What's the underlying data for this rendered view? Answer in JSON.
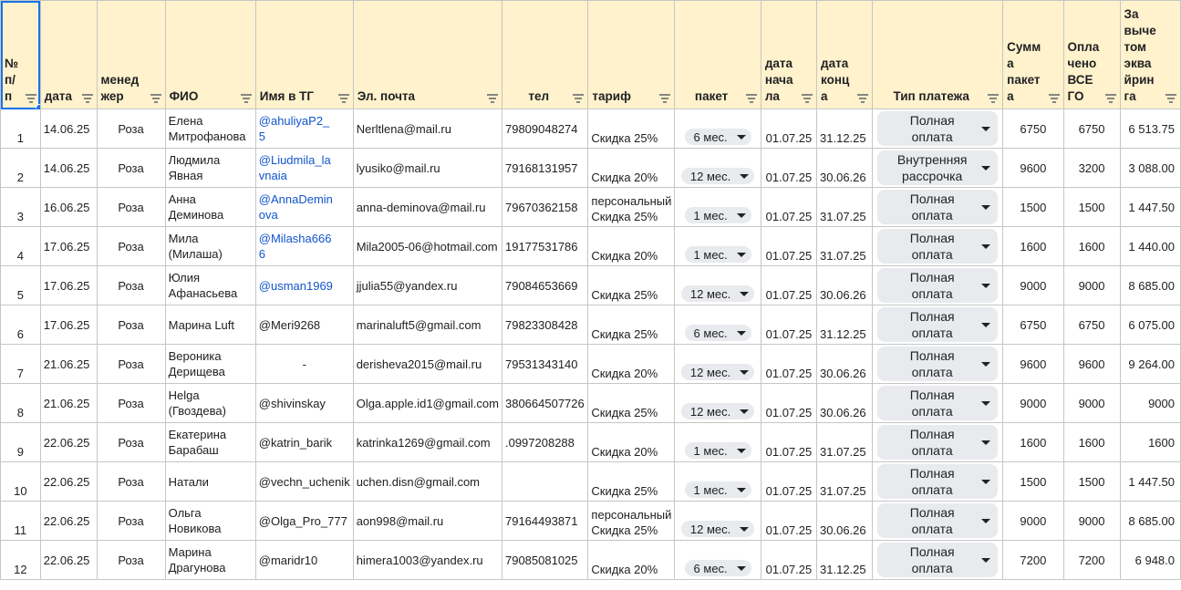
{
  "headers": [
    {
      "key": "n",
      "label": "№\nп/\nп"
    },
    {
      "key": "date",
      "label": "дата"
    },
    {
      "key": "manager",
      "label": "менед\nжер"
    },
    {
      "key": "fio",
      "label": "ФИО"
    },
    {
      "key": "tg",
      "label": "Имя в ТГ"
    },
    {
      "key": "email",
      "label": "Эл. почта"
    },
    {
      "key": "tel",
      "label": "тел"
    },
    {
      "key": "tariff",
      "label": "тариф"
    },
    {
      "key": "package",
      "label": "пакет"
    },
    {
      "key": "start",
      "label": "дата\nнача\nла"
    },
    {
      "key": "end",
      "label": "дата\nконц\nа"
    },
    {
      "key": "paytype",
      "label": "Тип платежа"
    },
    {
      "key": "sum",
      "label": "Сумм\nа\nпакет\nа"
    },
    {
      "key": "paid",
      "label": "Опла\nчено\nВСЕ\nГО"
    },
    {
      "key": "net",
      "label": "За\nвыче\nтом\nэква\nйрин\nга"
    }
  ],
  "rows": [
    {
      "n": "1",
      "date": "14.06.25",
      "manager": "Роза",
      "fio": "Елена\nМитрофанова",
      "tg": "@ahuliyaP2_\n5",
      "email": "Nerltlena@mail.ru",
      "tel": "79809048274",
      "tariff": "Скидка 25%",
      "package": "6 мес.",
      "start": "01.07.25",
      "end": "31.12.25",
      "paytype": "Полная\nоплата",
      "sum": "6750",
      "paid": "6750",
      "net": "6 513.75"
    },
    {
      "n": "2",
      "date": "14.06.25",
      "manager": "Роза",
      "fio": "Людмила\nЯвная",
      "tg": "@Liudmila_la\nvnaia",
      "email": "lyusiko@mail.ru",
      "tel": "79168131957",
      "tariff": "Скидка 20%",
      "package": "12 мес.",
      "start": "01.07.25",
      "end": "30.06.26",
      "paytype": "Внутренняя\nрассрочка",
      "sum": "9600",
      "paid": "3200",
      "net": "3 088.00"
    },
    {
      "n": "3",
      "date": "16.06.25",
      "manager": "Роза",
      "fio": "Анна\nДеминова",
      "tg": "@AnnaDemin\nova",
      "email": "anna-deminova@mail.ru",
      "tel": "79670362158",
      "tariff": "персональный\nСкидка 25%",
      "package": "1 мес.",
      "start": "01.07.25",
      "end": "31.07.25",
      "paytype": "Полная\nоплата",
      "sum": "1500",
      "paid": "1500",
      "net": "1 447.50"
    },
    {
      "n": "4",
      "date": "17.06.25",
      "manager": "Роза",
      "fio": "Мила (Милаша)",
      "tg": "@Milasha666\n6",
      "email": "Mila2005-06@hotmail.com",
      "tel": "19177531786",
      "tariff": "Скидка 20%",
      "package": "1 мес.",
      "start": "01.07.25",
      "end": "31.07.25",
      "paytype": "Полная\nоплата",
      "sum": "1600",
      "paid": "1600",
      "net": "1 440.00"
    },
    {
      "n": "5",
      "date": "17.06.25",
      "manager": "Роза",
      "fio": "Юлия Афанасьева",
      "tg": "@usman1969",
      "email": "jjulia55@yandex.ru",
      "tel": "79084653669",
      "tariff": "Скидка 25%",
      "package": "12 мес.",
      "start": "01.07.25",
      "end": "30.06.26",
      "paytype": "Полная\nоплата",
      "sum": "9000",
      "paid": "9000",
      "net": "8 685.00"
    },
    {
      "n": "6",
      "date": "17.06.25",
      "manager": "Роза",
      "fio": "Марина Luft",
      "tg": "@Meri9268",
      "email": "marinaluft5@gmail.com",
      "tel": "79823308428",
      "tariff": "Скидка 25%",
      "package": "6 мес.",
      "start": "01.07.25",
      "end": "31.12.25",
      "paytype": "Полная\nоплата",
      "sum": "6750",
      "paid": "6750",
      "net": "6 075.00"
    },
    {
      "n": "7",
      "date": "21.06.25",
      "manager": "Роза",
      "fio": "Вероника Дерищева",
      "tg": "-",
      "email": "derisheva2015@mail.ru",
      "tel": "79531343140",
      "tariff": "Скидка 20%",
      "package": "12 мес.",
      "start": "01.07.25",
      "end": "30.06.26",
      "paytype": "Полная\nоплата",
      "sum": "9600",
      "paid": "9600",
      "net": "9 264.00"
    },
    {
      "n": "8",
      "date": "21.06.25",
      "manager": "Роза",
      "fio": "Helga (Гвоздева)",
      "tg": "@shivinskay",
      "email": "Olga.apple.id1@gmail.com",
      "tel": "380664507726",
      "tariff": "Скидка 25%",
      "package": "12 мес.",
      "start": "01.07.25",
      "end": "30.06.26",
      "paytype": "Полная\nоплата",
      "sum": "9000",
      "paid": "9000",
      "net": "9000"
    },
    {
      "n": "9",
      "date": "22.06.25",
      "manager": "Роза",
      "fio": "Екатерина Барабаш",
      "tg": "@katrin_barik",
      "email": "katrinka1269@gmail.com",
      "tel": ".0997208288",
      "tariff": "Скидка 20%",
      "package": "1 мес.",
      "start": "01.07.25",
      "end": "31.07.25",
      "paytype": "Полная\nоплата",
      "sum": "1600",
      "paid": "1600",
      "net": "1600"
    },
    {
      "n": "10",
      "date": "22.06.25",
      "manager": "Роза",
      "fio": "Натали",
      "tg": "@vechn_uchenik",
      "email": "uchen.disn@gmail.com",
      "tel": "",
      "tariff": "Скидка 25%",
      "package": "1 мес.",
      "start": "01.07.25",
      "end": "31.07.25",
      "paytype": "Полная\nоплата",
      "sum": "1500",
      "paid": "1500",
      "net": "1 447.50"
    },
    {
      "n": "11",
      "date": "22.06.25",
      "manager": "Роза",
      "fio": "Ольга Новикова",
      "tg": "@Olga_Pro_777",
      "email": "aon998@mail.ru",
      "tel": "79164493871",
      "tariff": "персональный\nСкидка 25%",
      "package": "12 мес.",
      "start": "01.07.25",
      "end": "30.06.26",
      "paytype": "Полная\nоплата",
      "sum": "9000",
      "paid": "9000",
      "net": "8 685.00"
    },
    {
      "n": "12",
      "date": "22.06.25",
      "manager": "Роза",
      "fio": "Марина Драгунова",
      "tg": "@maridr10",
      "email": "himera1003@yandex.ru",
      "tel": "79085081025",
      "tariff": "Скидка 20%",
      "package": "6 мес.",
      "start": "01.07.25",
      "end": "31.12.25",
      "paytype": "Полная\nоплата",
      "sum": "7200",
      "paid": "7200",
      "net": "6 948.0"
    }
  ]
}
